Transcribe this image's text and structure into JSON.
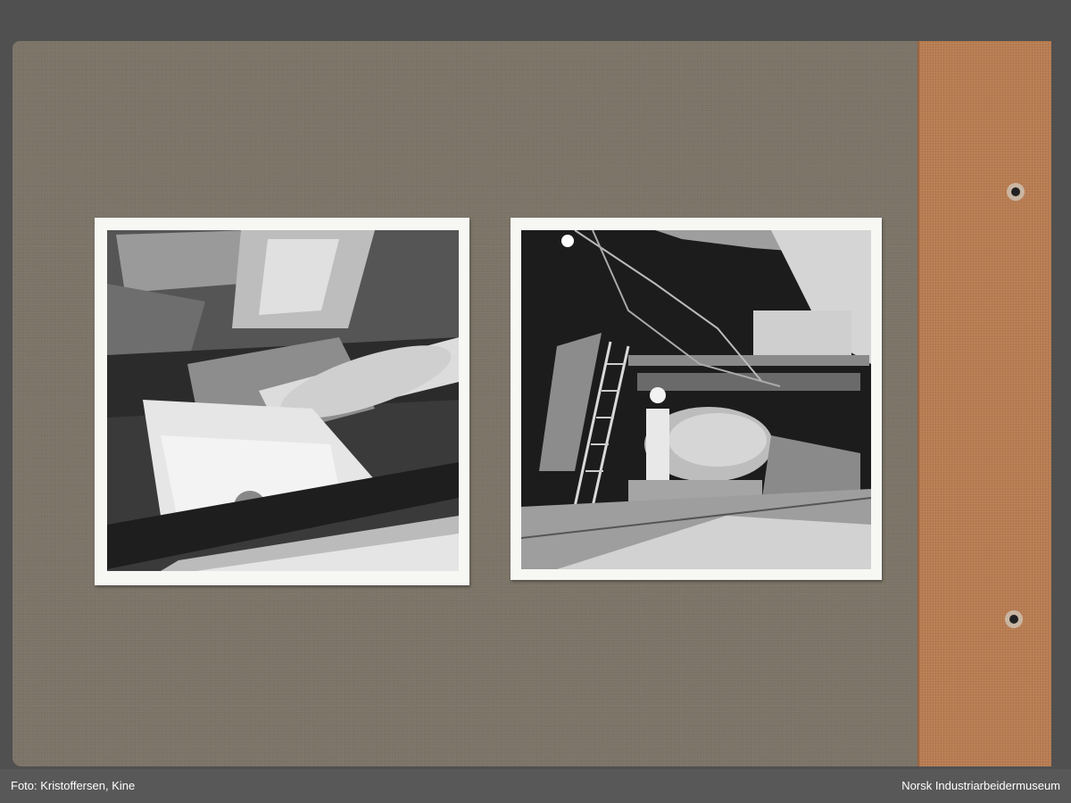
{
  "footer": {
    "credit": "Foto: Kristoffersen, Kine",
    "museum": "Norsk Industriarbeidermuseum"
  }
}
